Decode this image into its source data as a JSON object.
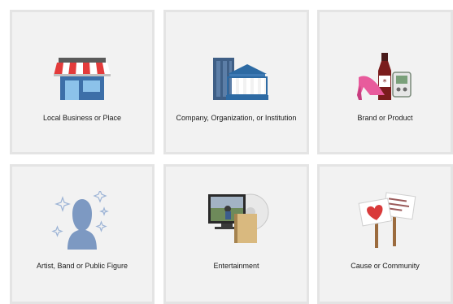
{
  "categories": [
    {
      "label": "Local Business or Place",
      "icon": "storefront-icon"
    },
    {
      "label": "Company, Organization, or Institution",
      "icon": "buildings-icon"
    },
    {
      "label": "Brand or Product",
      "icon": "products-icon"
    },
    {
      "label": "Artist, Band or Public Figure",
      "icon": "person-silhouette-icon"
    },
    {
      "label": "Entertainment",
      "icon": "tv-film-icon"
    },
    {
      "label": "Cause or Community",
      "icon": "protest-signs-icon"
    }
  ],
  "colors": {
    "card_bg": "#f2f2f2",
    "card_border": "#e4e4e4",
    "label_text": "#1a1a1a"
  }
}
